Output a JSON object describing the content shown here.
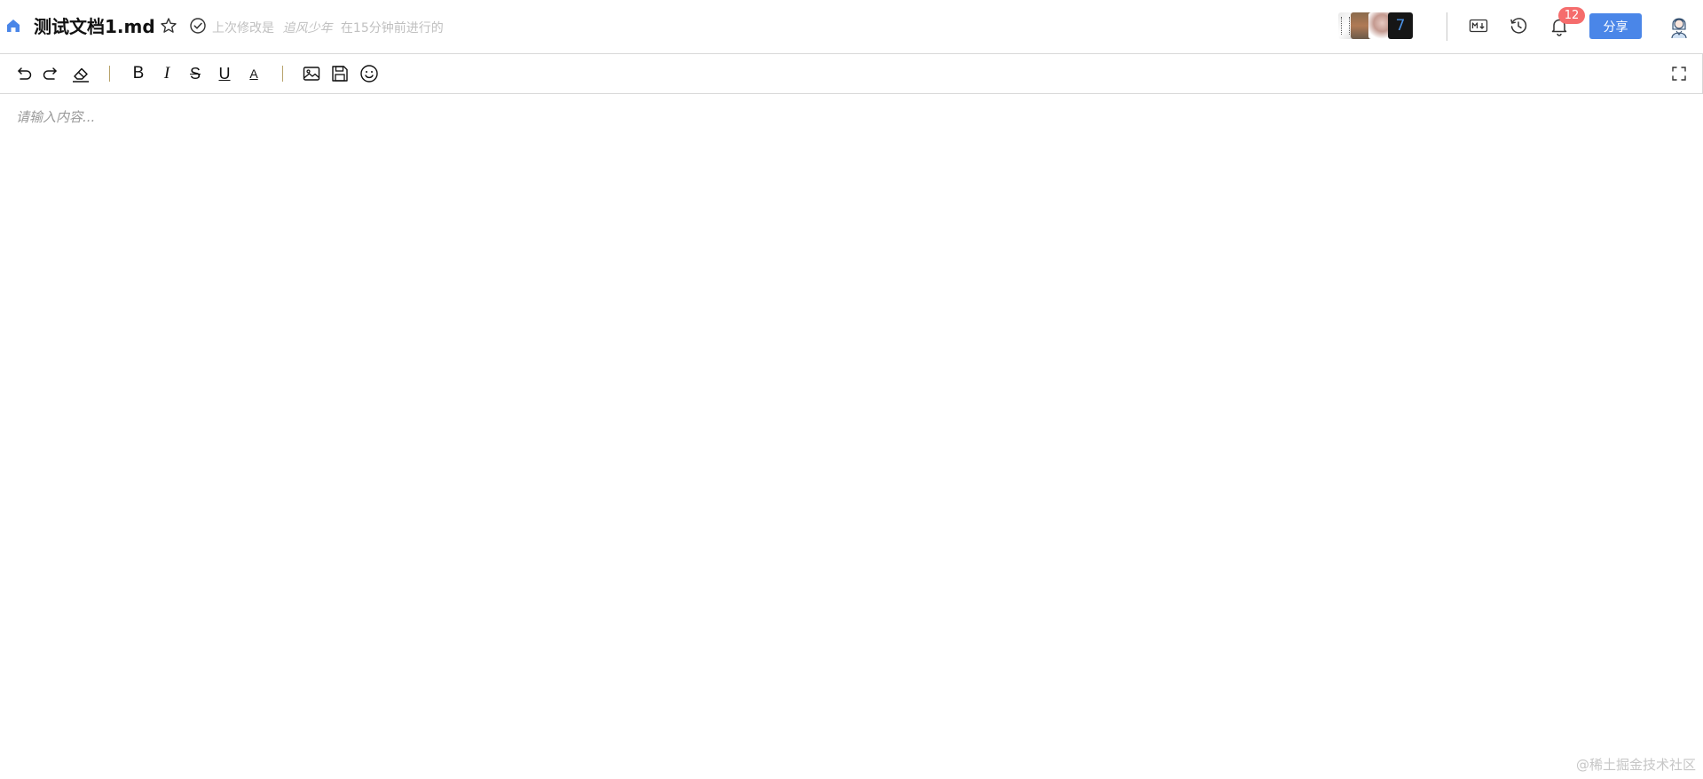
{
  "header": {
    "doc_title": "测试文档1.md",
    "last_modified_prefix": "上次修改是",
    "last_modified_author": "追风少年",
    "last_modified_suffix": "在15分钟前进行的",
    "collaborators_more": "7",
    "notifications_count": "12",
    "share_label": "分享"
  },
  "toolbar": {
    "bold_label": "B",
    "italic_label": "I",
    "strike_label": "S",
    "underline_label": "U",
    "color_label": "A",
    "items": [
      "undo-icon",
      "redo-icon",
      "eraser-icon",
      "bold",
      "italic",
      "strikethrough",
      "underline",
      "font-color",
      "image-icon",
      "save-icon",
      "emoji-icon",
      "fullscreen-icon"
    ]
  },
  "editor": {
    "placeholder": "请输入内容..."
  },
  "watermark": "@稀土掘金技术社区",
  "colors": {
    "accent": "#4a86e8",
    "badge": "#f56c6c",
    "separator": "#b7a26a",
    "muted_text": "#c0c0c0"
  }
}
